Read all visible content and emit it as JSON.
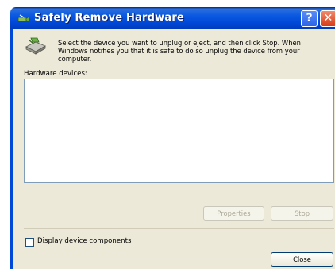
{
  "window": {
    "title": "Safely Remove Hardware",
    "help_glyph": "?",
    "close_glyph": "✕"
  },
  "description": "Select the device you want to unplug or eject, and then click Stop. When Windows notifies you that it is safe to do so unplug the device from your computer.",
  "devices_label": "Hardware devices:",
  "devices": [],
  "buttons": {
    "properties": "Properties",
    "stop": "Stop",
    "close": "Close"
  },
  "checkbox": {
    "label": "Display device components",
    "checked": false
  },
  "icons": {
    "title": "safely-remove-hardware-icon",
    "description": "hardware-device-icon"
  },
  "colors": {
    "titlebar": "#0048d8",
    "dialog_bg": "#ece9d8",
    "close_button": "#d63c19",
    "disabled_text": "#aca899"
  }
}
